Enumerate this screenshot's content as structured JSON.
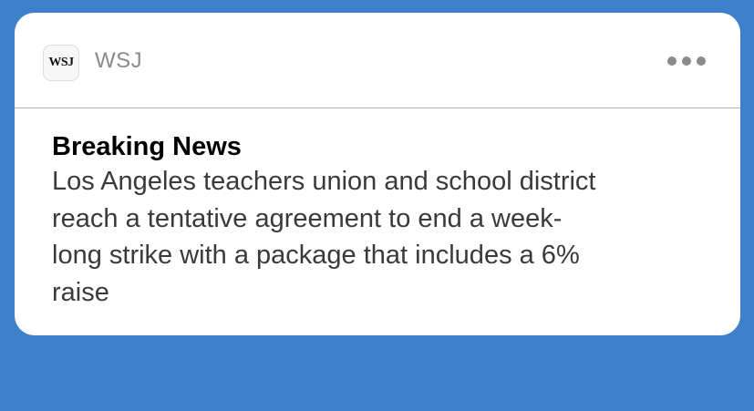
{
  "notification": {
    "app_icon_text": "WSJ",
    "app_name": "WSJ",
    "more_icon": "more-horizontal-icon",
    "title": "Breaking News",
    "body": "Los Angeles teachers union and school district\nreach a tentative agreement to end a week-\nlong strike with a package that includes a 6%\nraise"
  },
  "colors": {
    "background": "#3f80cd",
    "card": "#ffffff",
    "secondary_text": "#8a8a8a",
    "body_text": "#3a3a3a"
  }
}
